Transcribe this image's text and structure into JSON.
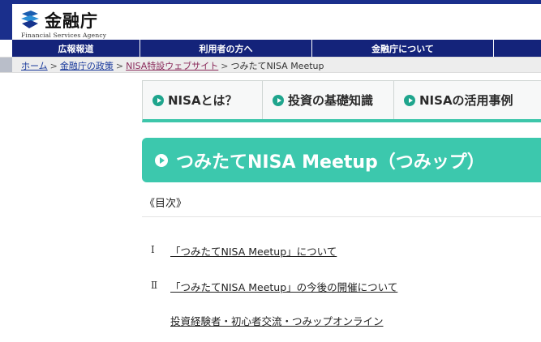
{
  "header": {
    "logo_title": "金融庁",
    "logo_subtitle": "Financial Services Agency"
  },
  "global_nav": [
    {
      "label": "広報報道"
    },
    {
      "label": "利用者の方へ"
    },
    {
      "label": "金融庁について"
    },
    {
      "label": ""
    }
  ],
  "breadcrumb": {
    "home": "ホーム",
    "policy": "金融庁の政策",
    "nisa_site": "NISA特設ウェブサイト",
    "current": "つみたてNISA Meetup",
    "separator": ">"
  },
  "tabs": [
    {
      "label": "NISAとは？"
    },
    {
      "label": "投資の基礎知識"
    },
    {
      "label": "NISAの活用事例"
    }
  ],
  "page_title": "つみたてNISA Meetup（つみップ）",
  "toc": {
    "heading": "《目次》",
    "items": [
      {
        "number": "Ⅰ",
        "label": "「つみたてNISA Meetup」について"
      },
      {
        "number": "Ⅱ",
        "label": "「つみたてNISA Meetup」の今後の開催について"
      },
      {
        "number": "",
        "label": "投資経験者・初心者交流・つみップオンライン"
      }
    ]
  },
  "colors": {
    "nav_navy": "#14237a",
    "accent_teal": "#3cc8ad",
    "link_blue": "#1a3a9c",
    "link_visited": "#8a2a5a"
  }
}
